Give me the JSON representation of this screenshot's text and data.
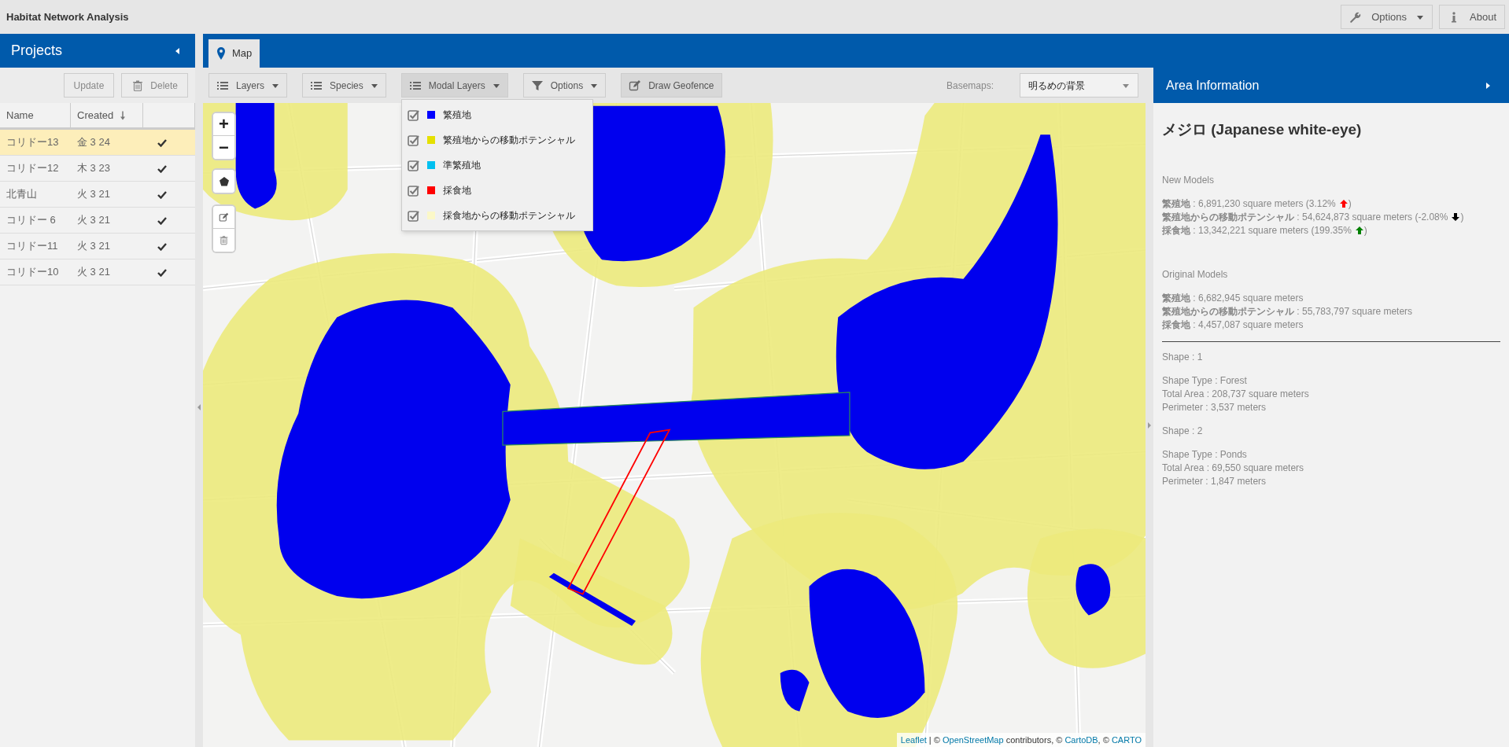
{
  "app_title": "Habitat Network Analysis",
  "header_buttons": [
    {
      "kind": "settings",
      "label": "Options"
    },
    {
      "kind": "about",
      "label": "About"
    }
  ],
  "projects": {
    "title": "Projects",
    "buttons": [
      {
        "kind": "update",
        "label": "Update"
      },
      {
        "kind": "delete",
        "label": "Delete"
      }
    ],
    "columns": [
      "Name",
      "Created"
    ],
    "rows": [
      {
        "name": "コリドー13",
        "created": "金 3 24",
        "checked": true,
        "selected": true
      },
      {
        "name": "コリドー12",
        "created": "木 3 23",
        "checked": true,
        "selected": false
      },
      {
        "name": "北青山",
        "created": "火 3 21",
        "checked": true,
        "selected": false
      },
      {
        "name": "コリドー 6",
        "created": "火 3 21",
        "checked": true,
        "selected": false
      },
      {
        "name": "コリドー11",
        "created": "火 3 21",
        "checked": true,
        "selected": false
      },
      {
        "name": "コリドー10",
        "created": "火 3 21",
        "checked": true,
        "selected": false
      }
    ]
  },
  "map_tab": {
    "label": "Map",
    "selected": true
  },
  "toolbar": [
    {
      "kind": "list",
      "label": "Layers",
      "open": false
    },
    {
      "kind": "list",
      "label": "Species",
      "open": false
    },
    {
      "kind": "list",
      "label": "Modal Layers",
      "open": true
    },
    {
      "kind": "filter",
      "label": "Options",
      "open": false
    },
    {
      "kind": "draw",
      "label": "Draw Geofence"
    }
  ],
  "modal_layers": [
    {
      "label": "繁殖地",
      "checked": true,
      "color": "#0000ff"
    },
    {
      "label": "繁殖地からの移動ポテンシャル",
      "checked": true,
      "color": "#e5e000"
    },
    {
      "label": "準繁殖地",
      "checked": true,
      "color": "#00c0f0"
    },
    {
      "label": "採食地",
      "checked": true,
      "color": "#ff0000"
    },
    {
      "label": "採食地からの移動ポテンシャル",
      "checked": true,
      "color": "#fbf8c8"
    }
  ],
  "basemaps": {
    "label": "Basemaps:",
    "value": "明るめの背景"
  },
  "map_controls": {
    "zoom_in": "+",
    "zoom_out": "−"
  },
  "attribution": [
    {
      "text": "Leaflet",
      "kind": "link"
    },
    {
      "text": " | © ",
      "kind": "text"
    },
    {
      "text": "OpenStreetMap",
      "kind": "link"
    },
    {
      "text": " contributors, © ",
      "kind": "text"
    },
    {
      "text": "CartoDB",
      "kind": "link"
    },
    {
      "text": ", © ",
      "kind": "text"
    },
    {
      "text": "CARTO",
      "kind": "link"
    }
  ],
  "area_info": {
    "title": "Area Information",
    "species": "メジロ (Japanese white-eye)",
    "new_models": {
      "heading": "New Models",
      "lines": [
        {
          "text": "**繁殖地** : 6,891,230 square meters (3.12%",
          "kind": "up",
          "color": "#ff0000",
          "suffix": ")"
        },
        {
          "text": "**繁殖地からの移動ポテンシャル** : 54,624,873 square meters (-2.08%",
          "kind": "down",
          "color": "#000000",
          "suffix": ")"
        },
        {
          "text": "**採食地** : 13,342,221 square meters (199.35%",
          "kind": "up",
          "color": "#008000",
          "suffix": ")"
        }
      ]
    },
    "original_models": {
      "heading": "Original Models",
      "lines": [
        {
          "text": "**繁殖地** : 6,682,945 square meters"
        },
        {
          "text": "**繁殖地からの移動ポテンシャル** : 55,783,797 square meters"
        },
        {
          "text": "**採食地** : 4,457,087 square meters"
        }
      ]
    },
    "shapes": [
      {
        "heading": "Shape : 1",
        "lines": [
          "Shape Type : Forest",
          "Total Area : 208,737 square meters",
          "Perimeter : 3,537 meters"
        ]
      },
      {
        "heading": "Shape : 2",
        "lines": [
          "Shape Type : Ponds",
          "Total Area : 69,550 square meters",
          "Perimeter : 1,847 meters"
        ]
      }
    ]
  }
}
